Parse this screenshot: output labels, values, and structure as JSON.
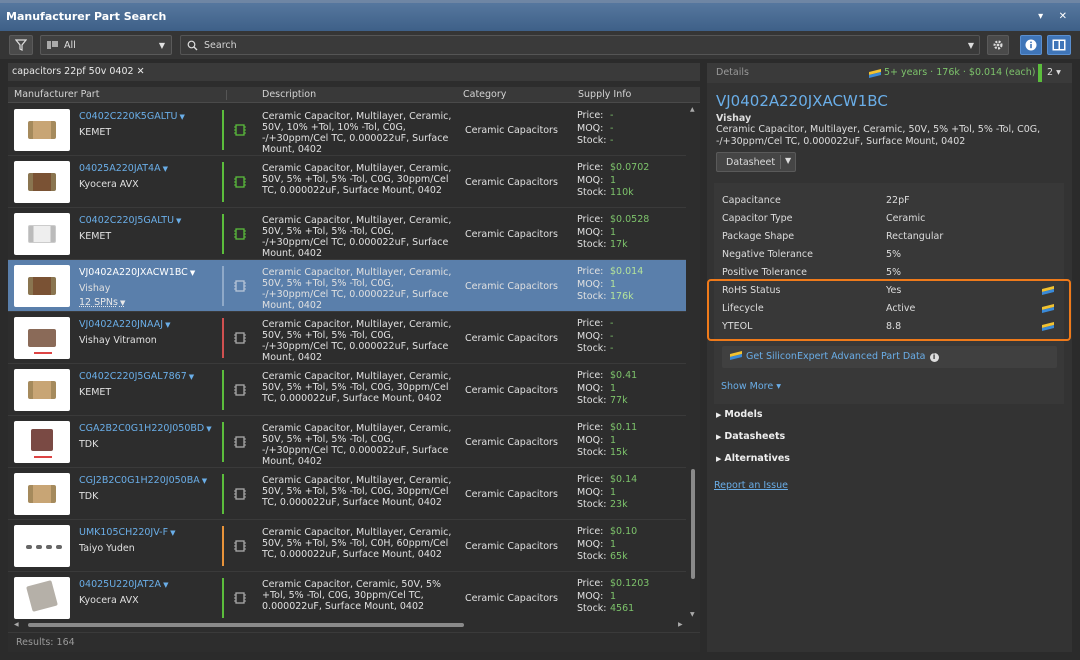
{
  "window": {
    "title": "Manufacturer Part Search",
    "controls": "▾ ✕"
  },
  "toolbar": {
    "filter_icon": "filter-icon",
    "category": "All",
    "search_placeholder": "Search"
  },
  "query_chip": {
    "text": "capacitors 22pf 50v 0402"
  },
  "columns": [
    "Manufacturer Part",
    "Description",
    "Category",
    "Supply Info"
  ],
  "supply_labels": {
    "price": "Price:",
    "moq": "MOQ:",
    "stock": "Stock:"
  },
  "parts": [
    {
      "mpn": "C0402C220K5GALTU",
      "mfr": "KEMET",
      "desc": "Ceramic Capacitor, Multilayer, Ceramic, 50V, 10% +Tol, 10% -Tol, C0G, -/+30ppm/Cel TC, 0.000022uF, Surface Mount, 0402",
      "category": "Ceramic Capacitors",
      "price": "-",
      "moq": "-",
      "stock": "-",
      "bar_color": "#5bbd3c",
      "symbol_color": "#5bbd3c"
    },
    {
      "mpn": "04025A220JAT4A",
      "mfr": "Kyocera AVX",
      "desc": "Ceramic Capacitor, Multilayer, Ceramic, 50V, 5% +Tol, 5% -Tol, C0G, 30ppm/Cel TC, 0.000022uF, Surface Mount, 0402",
      "category": "Ceramic Capacitors",
      "price": "$0.0702",
      "moq": "1",
      "stock": "110k",
      "bar_color": "#5bbd3c",
      "symbol_color": "#5bbd3c"
    },
    {
      "mpn": "C0402C220J5GALTU",
      "mfr": "KEMET",
      "desc": "Ceramic Capacitor, Multilayer, Ceramic, 50V, 5% +Tol, 5% -Tol, C0G, -/+30ppm/Cel TC, 0.000022uF, Surface Mount, 0402",
      "category": "Ceramic Capacitors",
      "price": "$0.0528",
      "moq": "1",
      "stock": "17k",
      "bar_color": "#5bbd3c",
      "symbol_color": "#5bbd3c"
    },
    {
      "mpn": "VJ0402A220JXACW1BC",
      "mfr": "Vishay",
      "spn": "12 SPNs",
      "desc": "Ceramic Capacitor, Multilayer, Ceramic, 50V, 5% +Tol, 5% -Tol, C0G, -/+30ppm/Cel TC, 0.000022uF, Surface Mount, 0402",
      "category": "Ceramic Capacitors",
      "price": "$0.014",
      "moq": "1",
      "stock": "176k",
      "bar_color": "#8fa9c8",
      "symbol_color": "#b8c6d8"
    },
    {
      "mpn": "VJ0402A220JNAAJ",
      "mfr": "Vishay Vitramon",
      "desc": "Ceramic Capacitor, Multilayer, Ceramic, 50V, 5% +Tol, 5% -Tol, C0G, -/+30ppm/Cel TC, 0.000022uF, Surface Mount, 0402",
      "category": "Ceramic Capacitors",
      "price": "-",
      "moq": "-",
      "stock": "-",
      "bar_color": "#d05050",
      "symbol_color": "#aaaaaa"
    },
    {
      "mpn": "C0402C220J5GAL7867",
      "mfr": "KEMET",
      "desc": "Ceramic Capacitor, Multilayer, Ceramic, 50V, 5% +Tol, 5% -Tol, C0G, 30ppm/Cel TC, 0.000022uF, Surface Mount, 0402",
      "category": "Ceramic Capacitors",
      "price": "$0.41",
      "moq": "1",
      "stock": "77k",
      "bar_color": "#5bbd3c",
      "symbol_color": "#aaaaaa"
    },
    {
      "mpn": "CGA2B2C0G1H220J050BD",
      "mfr": "TDK",
      "desc": "Ceramic Capacitor, Multilayer, Ceramic, 50V, 5% +Tol, 5% -Tol, C0G, -/+30ppm/Cel TC, 0.000022uF, Surface Mount, 0402",
      "category": "Ceramic Capacitors",
      "price": "$0.11",
      "moq": "1",
      "stock": "15k",
      "bar_color": "#5bbd3c",
      "symbol_color": "#aaaaaa"
    },
    {
      "mpn": "CGJ2B2C0G1H220J050BA",
      "mfr": "TDK",
      "desc": "Ceramic Capacitor, Multilayer, Ceramic, 50V, 5% +Tol, 5% -Tol, C0G, 30ppm/Cel TC, 0.000022uF, Surface Mount, 0402",
      "category": "Ceramic Capacitors",
      "price": "$0.14",
      "moq": "1",
      "stock": "23k",
      "bar_color": "#5bbd3c",
      "symbol_color": "#aaaaaa"
    },
    {
      "mpn": "UMK105CH220JV-F",
      "mfr": "Taiyo Yuden",
      "desc": "Ceramic Capacitor, Multilayer, Ceramic, 50V, 5% +Tol, 5% -Tol, C0H, 60ppm/Cel TC, 0.000022uF, Surface Mount, 0402",
      "category": "Ceramic Capacitors",
      "price": "$0.10",
      "moq": "1",
      "stock": "65k",
      "bar_color": "#e8933a",
      "symbol_color": "#aaaaaa"
    },
    {
      "mpn": "04025U220JAT2A",
      "mfr": "Kyocera AVX",
      "desc": "Ceramic Capacitor, Ceramic, 50V, 5% +Tol, 5% -Tol, C0G, 30ppm/Cel TC, 0.000022uF, Surface Mount, 0402",
      "category": "Ceramic Capacitors",
      "price": "$0.1203",
      "moq": "1",
      "stock": "4561",
      "bar_color": "#5bbd3c",
      "symbol_color": "#aaaaaa"
    }
  ],
  "results": "Results: 164",
  "details": {
    "header": "Details",
    "stats": "5+ years · 176k · $0.014 (each)",
    "count": "2 ▾",
    "part_number": "VJ0402A220JXACW1BC",
    "manufacturer": "Vishay",
    "description": "Ceramic Capacitor, Multilayer, Ceramic, 50V, 5% +Tol, 5% -Tol, C0G, -/+30ppm/Cel TC, 0.000022uF, Surface Mount, 0402",
    "datasheet_label": "Datasheet",
    "properties": [
      {
        "key": "Capacitance",
        "value": "22pF"
      },
      {
        "key": "Capacitor Type",
        "value": "Ceramic"
      },
      {
        "key": "Package Shape",
        "value": "Rectangular"
      },
      {
        "key": "Negative Tolerance",
        "value": "5%"
      },
      {
        "key": "Positive Tolerance",
        "value": "5%"
      },
      {
        "key": "RoHS Status",
        "value": "Yes",
        "silicon_expert": true
      },
      {
        "key": "Lifecycle",
        "value": "Active",
        "silicon_expert": true
      },
      {
        "key": "YTEOL",
        "value": "8.8",
        "silicon_expert": true
      }
    ],
    "advanced_link": "Get SiliconExpert Advanced Part Data",
    "show_more": "Show More ▾",
    "sections": [
      "Models",
      "Datasheets",
      "Alternatives"
    ],
    "report": "Report an Issue"
  },
  "colors": {
    "accent": "#6aaee8",
    "highlight": "#ef7a1a",
    "selected_row": "#5a7fab",
    "in_stock": "#7dc36b"
  }
}
